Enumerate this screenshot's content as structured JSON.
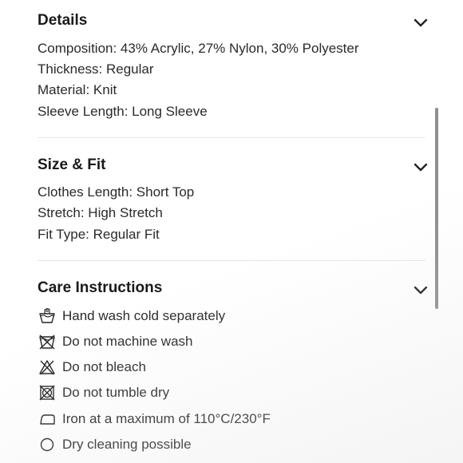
{
  "details": {
    "title": "Details",
    "lines": [
      "Composition: 43% Acrylic, 27% Nylon, 30% Polyester",
      "Thickness: Regular",
      "Material: Knit",
      "Sleeve Length: Long Sleeve"
    ]
  },
  "size_fit": {
    "title": "Size & Fit",
    "lines": [
      "Clothes Length: Short Top",
      "Stretch: High Stretch",
      "Fit Type: Regular Fit"
    ]
  },
  "care": {
    "title": "Care Instructions",
    "items": [
      {
        "icon": "hand-wash-icon",
        "text": "Hand wash cold separately"
      },
      {
        "icon": "no-machine-wash-icon",
        "text": "Do not machine wash"
      },
      {
        "icon": "no-bleach-icon",
        "text": "Do not bleach"
      },
      {
        "icon": "no-tumble-dry-icon",
        "text": "Do not tumble dry"
      },
      {
        "icon": "iron-icon",
        "text": "Iron at a maximum of 110°C/230°F"
      },
      {
        "icon": "dry-clean-icon",
        "text": "Dry cleaning possible"
      }
    ]
  },
  "colors": {
    "text": "#2a2a2a",
    "title": "#1a1a1a",
    "divider": "#e6e6e6",
    "scrollbar": "#8e8e8e"
  }
}
